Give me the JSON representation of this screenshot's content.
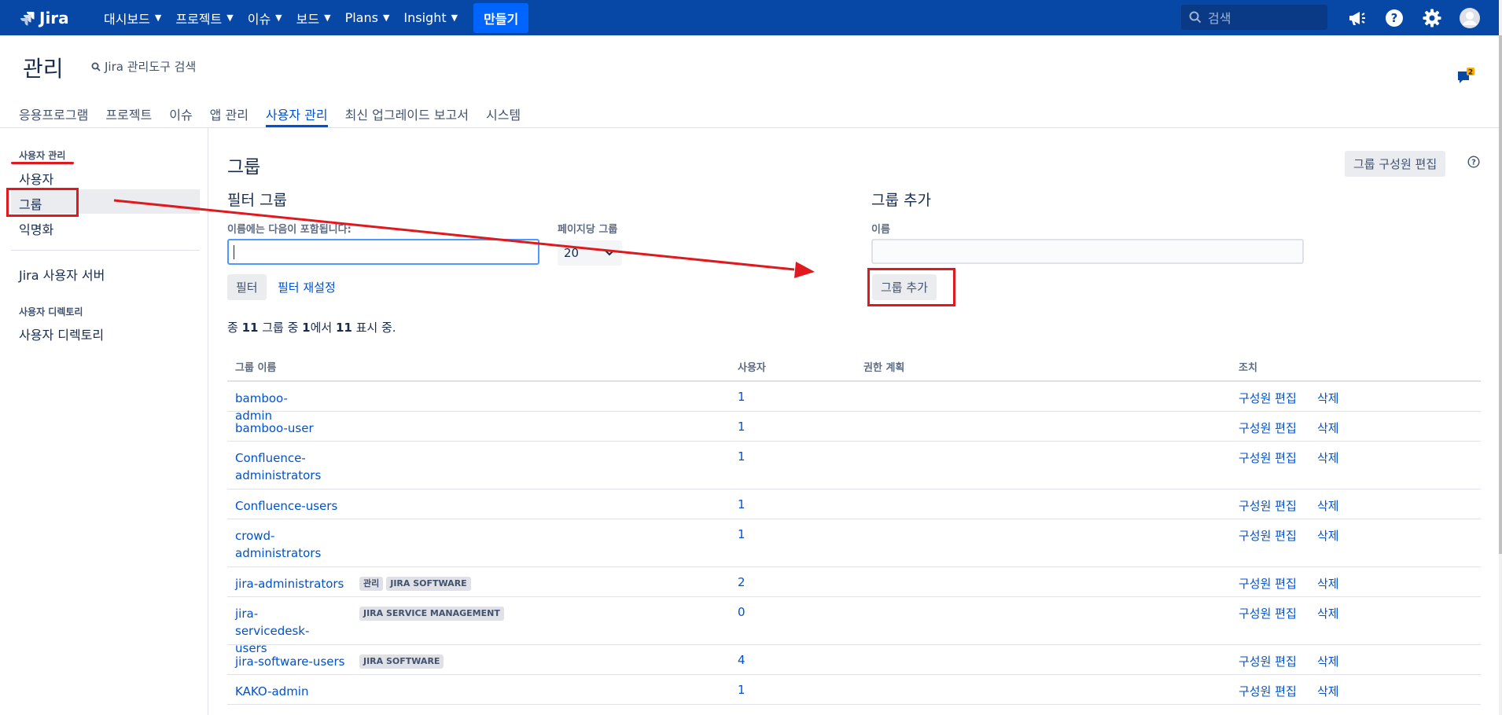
{
  "topbar": {
    "logo_text": "Jira",
    "nav": [
      {
        "label": "대시보드"
      },
      {
        "label": "프로젝트"
      },
      {
        "label": "이슈"
      },
      {
        "label": "보드"
      },
      {
        "label": "Plans"
      },
      {
        "label": "Insight"
      }
    ],
    "create_label": "만들기",
    "search_placeholder": "검색",
    "icons": [
      "megaphone-icon",
      "help-icon",
      "gear-icon",
      "avatar-icon"
    ],
    "colors": {
      "bar": "#0747a6",
      "create": "#0065ff"
    }
  },
  "admin": {
    "title": "관리",
    "search_label": "Jira 관리도구 검색",
    "feedback_badge": "2",
    "tabs": [
      {
        "label": "응용프로그램"
      },
      {
        "label": "프로젝트"
      },
      {
        "label": "이슈"
      },
      {
        "label": "앱 관리"
      },
      {
        "label": "사용자 관리"
      },
      {
        "label": "최신 업그레이드 보고서"
      },
      {
        "label": "시스템"
      }
    ],
    "active_tab": "사용자 관리"
  },
  "sidebar": {
    "section1_heading": "사용자 관리",
    "items1": [
      {
        "label": "사용자"
      },
      {
        "label": "그룹"
      },
      {
        "label": "익명화"
      }
    ],
    "selected_item": "그룹",
    "jira_user_server": "Jira 사용자 서버",
    "section2_heading": "사용자 디렉토리",
    "items2": [
      {
        "label": "사용자 디렉토리"
      }
    ]
  },
  "main": {
    "title": "그룹",
    "edit_members_button": "그룹 구성원 편집",
    "filter": {
      "title": "필터 그룹",
      "name_label": "이름에는 다음이 포함됩니다:",
      "name_value": "",
      "per_page_label": "페이지당 그룹",
      "per_page_value": "20",
      "filter_button": "필터",
      "reset_link": "필터 재설정"
    },
    "add_group": {
      "title": "그룹 추가",
      "name_label": "이름",
      "name_value": "",
      "add_button": "그룹 추가"
    },
    "summary": {
      "prefix": "종 ",
      "total": "11",
      "mid1": " 그룹 중 ",
      "start": "1",
      "mid2": "에서 ",
      "end": "11",
      "suffix": " 표시 중."
    },
    "table": {
      "headers": {
        "name": "그룹 이름",
        "users": "사용자",
        "permissions": "권한 계획",
        "actions": "조치"
      },
      "edit_label": "구성원 편집",
      "delete_label": "삭제",
      "rows": [
        {
          "name": "bamboo-admin",
          "users": "1",
          "lozenges": []
        },
        {
          "name": "bamboo-user",
          "users": "1",
          "lozenges": []
        },
        {
          "name": "Confluence-administrators",
          "users": "1",
          "lozenges": []
        },
        {
          "name": "Confluence-users",
          "users": "1",
          "lozenges": []
        },
        {
          "name": "crowd-administrators",
          "users": "1",
          "lozenges": []
        },
        {
          "name": "jira-administrators",
          "users": "2",
          "lozenges": [
            "관리",
            "JIRA SOFTWARE"
          ]
        },
        {
          "name": "jira-servicedesk-users",
          "users": "0",
          "lozenges": [
            "JIRA SERVICE MANAGEMENT"
          ]
        },
        {
          "name": "jira-software-users",
          "users": "4",
          "lozenges": [
            "JIRA SOFTWARE"
          ]
        },
        {
          "name": "KAKO-admin",
          "users": "1",
          "lozenges": []
        }
      ]
    }
  },
  "annotation_color": "#e0191f"
}
